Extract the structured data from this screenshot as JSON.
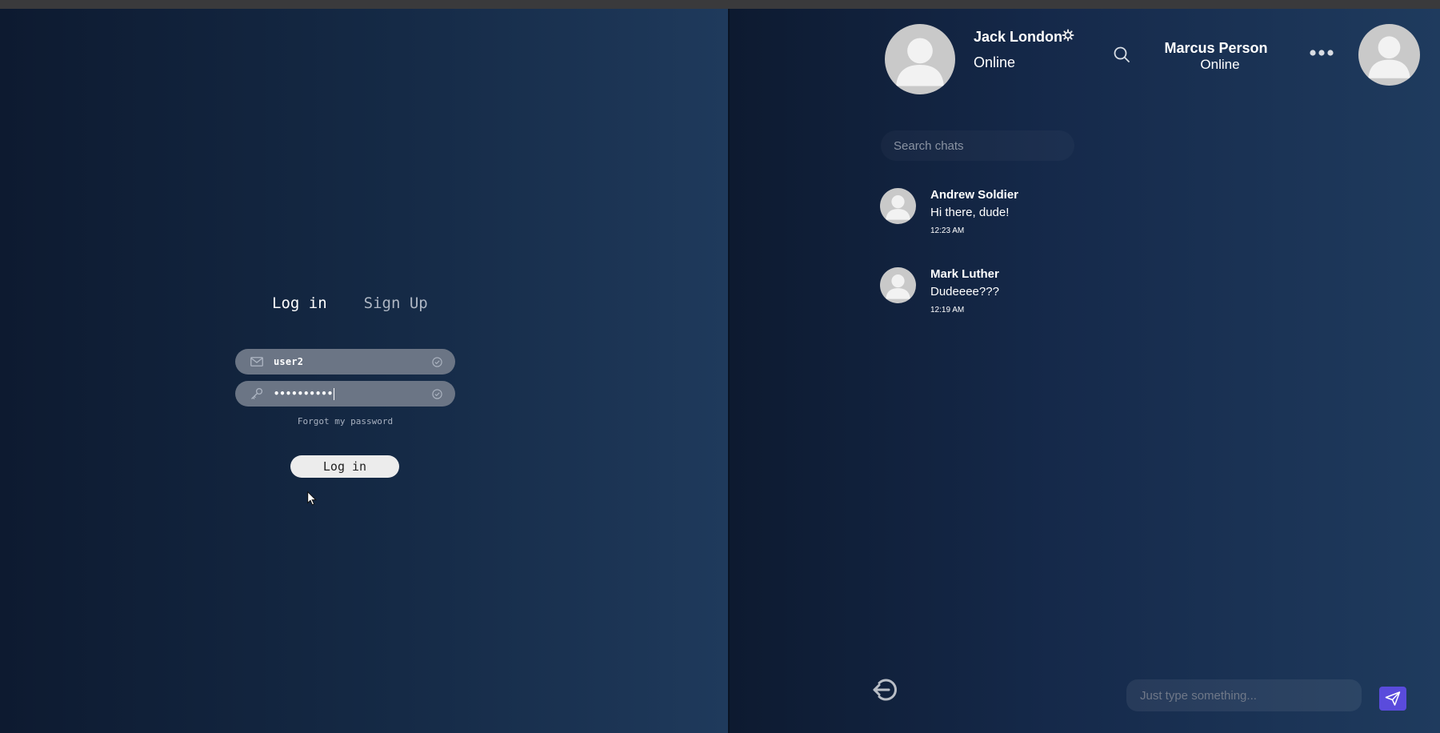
{
  "login": {
    "tabs": {
      "login": "Log in",
      "signup": "Sign Up"
    },
    "username_value": "user2",
    "password_value": "••••••••••",
    "forgot_link": "Forgot my password",
    "submit_label": "Log in"
  },
  "chat": {
    "current_user": {
      "name": "Jack London",
      "status": "Online"
    },
    "active_contact": {
      "name": "Marcus Person",
      "status": "Online"
    },
    "search_placeholder": "Search chats",
    "conversations": [
      {
        "name": "Andrew Soldier",
        "last_message": "Hi there, dude!",
        "time": "12:23 AM"
      },
      {
        "name": "Mark Luther",
        "last_message": "Dudeeee???",
        "time": "12:19 AM"
      }
    ],
    "message_placeholder": "Just type something..."
  },
  "colors": {
    "background_dark": "#0d1a30",
    "background_light": "#1f3b5e",
    "input_fill": "#6b7585",
    "send_button": "#5a4bdc",
    "avatar": "#c9c9c9"
  },
  "icons": [
    "mail-icon",
    "key-icon",
    "check-circle-icon",
    "cursor-pointer-icon",
    "gear-icon",
    "search-icon",
    "more-dots-icon",
    "logout-icon",
    "send-icon",
    "user-avatar-icon"
  ]
}
